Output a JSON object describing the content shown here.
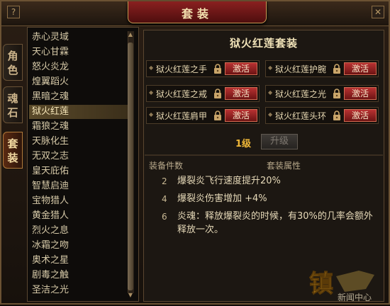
{
  "window": {
    "title": "套装",
    "help_glyph": "?",
    "close_glyph": "✕"
  },
  "tabs": [
    {
      "label": "角色",
      "active": false
    },
    {
      "label": "魂石",
      "active": false
    },
    {
      "label": "套装",
      "active": true
    }
  ],
  "set_list": {
    "items": [
      "赤心灵域",
      "天心甘霖",
      "怒火炎龙",
      "煌翼蹈火",
      "黑暗之魂",
      "狱火红莲",
      "霜狼之魂",
      "天脉化生",
      "无双之志",
      "皇天庇佑",
      "智慧启迪",
      "宝物猎人",
      "黄金猎人",
      "烈火之息",
      "冰霜之吻",
      "奥术之星",
      "剧毒之触",
      "圣洁之光"
    ],
    "selected": "狱火红莲"
  },
  "detail": {
    "set_name": "狱火红莲套装",
    "pieces": [
      {
        "name": "狱火红莲之手",
        "button": "激活"
      },
      {
        "name": "狱火红莲护腕",
        "button": "激活"
      },
      {
        "name": "狱火红莲之戒",
        "button": "激活"
      },
      {
        "name": "狱火红莲之光",
        "button": "激活"
      },
      {
        "name": "狱火红莲肩甲",
        "button": "激活"
      },
      {
        "name": "狱火红莲头环",
        "button": "激活"
      }
    ],
    "level": "1级",
    "upgrade_label": "升级",
    "attr_header": {
      "count": "装备件数",
      "attr": "套装属性"
    },
    "bonuses": [
      {
        "count": "2",
        "text": "爆裂炎飞行速度提升20%"
      },
      {
        "count": "4",
        "text": "爆裂炎伤害增加 +4%"
      },
      {
        "count": "6",
        "text": "炎魂：释放爆裂炎的时候，有30%的几率会额外释放一次。"
      }
    ]
  },
  "watermark": {
    "logo_text": "镇",
    "site_text": "新闻中心"
  },
  "colors": {
    "activate_button": "#b83232",
    "selected_row": "#5a4a2a",
    "level_text": "#f0b838"
  }
}
